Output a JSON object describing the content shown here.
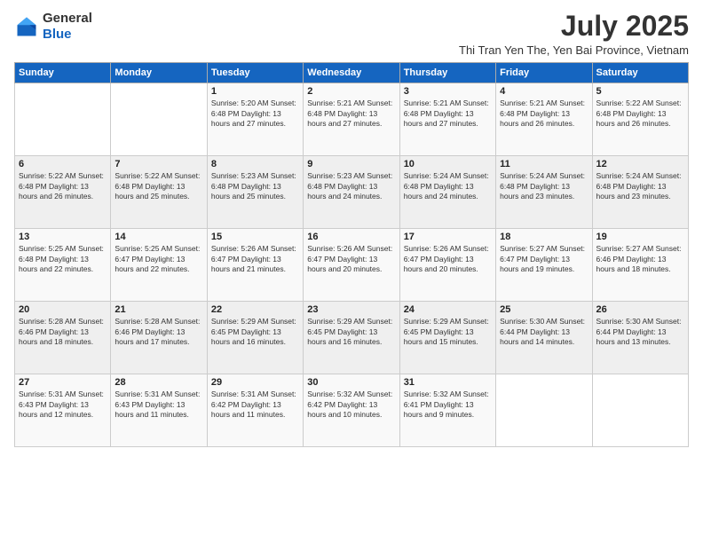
{
  "logo": {
    "line1": "General",
    "line2": "Blue"
  },
  "header": {
    "month_year": "July 2025",
    "location": "Thi Tran Yen The, Yen Bai Province, Vietnam"
  },
  "weekdays": [
    "Sunday",
    "Monday",
    "Tuesday",
    "Wednesday",
    "Thursday",
    "Friday",
    "Saturday"
  ],
  "weeks": [
    [
      {
        "day": "",
        "info": ""
      },
      {
        "day": "",
        "info": ""
      },
      {
        "day": "1",
        "info": "Sunrise: 5:20 AM\nSunset: 6:48 PM\nDaylight: 13 hours and 27 minutes."
      },
      {
        "day": "2",
        "info": "Sunrise: 5:21 AM\nSunset: 6:48 PM\nDaylight: 13 hours and 27 minutes."
      },
      {
        "day": "3",
        "info": "Sunrise: 5:21 AM\nSunset: 6:48 PM\nDaylight: 13 hours and 27 minutes."
      },
      {
        "day": "4",
        "info": "Sunrise: 5:21 AM\nSunset: 6:48 PM\nDaylight: 13 hours and 26 minutes."
      },
      {
        "day": "5",
        "info": "Sunrise: 5:22 AM\nSunset: 6:48 PM\nDaylight: 13 hours and 26 minutes."
      }
    ],
    [
      {
        "day": "6",
        "info": "Sunrise: 5:22 AM\nSunset: 6:48 PM\nDaylight: 13 hours and 26 minutes."
      },
      {
        "day": "7",
        "info": "Sunrise: 5:22 AM\nSunset: 6:48 PM\nDaylight: 13 hours and 25 minutes."
      },
      {
        "day": "8",
        "info": "Sunrise: 5:23 AM\nSunset: 6:48 PM\nDaylight: 13 hours and 25 minutes."
      },
      {
        "day": "9",
        "info": "Sunrise: 5:23 AM\nSunset: 6:48 PM\nDaylight: 13 hours and 24 minutes."
      },
      {
        "day": "10",
        "info": "Sunrise: 5:24 AM\nSunset: 6:48 PM\nDaylight: 13 hours and 24 minutes."
      },
      {
        "day": "11",
        "info": "Sunrise: 5:24 AM\nSunset: 6:48 PM\nDaylight: 13 hours and 23 minutes."
      },
      {
        "day": "12",
        "info": "Sunrise: 5:24 AM\nSunset: 6:48 PM\nDaylight: 13 hours and 23 minutes."
      }
    ],
    [
      {
        "day": "13",
        "info": "Sunrise: 5:25 AM\nSunset: 6:48 PM\nDaylight: 13 hours and 22 minutes."
      },
      {
        "day": "14",
        "info": "Sunrise: 5:25 AM\nSunset: 6:47 PM\nDaylight: 13 hours and 22 minutes."
      },
      {
        "day": "15",
        "info": "Sunrise: 5:26 AM\nSunset: 6:47 PM\nDaylight: 13 hours and 21 minutes."
      },
      {
        "day": "16",
        "info": "Sunrise: 5:26 AM\nSunset: 6:47 PM\nDaylight: 13 hours and 20 minutes."
      },
      {
        "day": "17",
        "info": "Sunrise: 5:26 AM\nSunset: 6:47 PM\nDaylight: 13 hours and 20 minutes."
      },
      {
        "day": "18",
        "info": "Sunrise: 5:27 AM\nSunset: 6:47 PM\nDaylight: 13 hours and 19 minutes."
      },
      {
        "day": "19",
        "info": "Sunrise: 5:27 AM\nSunset: 6:46 PM\nDaylight: 13 hours and 18 minutes."
      }
    ],
    [
      {
        "day": "20",
        "info": "Sunrise: 5:28 AM\nSunset: 6:46 PM\nDaylight: 13 hours and 18 minutes."
      },
      {
        "day": "21",
        "info": "Sunrise: 5:28 AM\nSunset: 6:46 PM\nDaylight: 13 hours and 17 minutes."
      },
      {
        "day": "22",
        "info": "Sunrise: 5:29 AM\nSunset: 6:45 PM\nDaylight: 13 hours and 16 minutes."
      },
      {
        "day": "23",
        "info": "Sunrise: 5:29 AM\nSunset: 6:45 PM\nDaylight: 13 hours and 16 minutes."
      },
      {
        "day": "24",
        "info": "Sunrise: 5:29 AM\nSunset: 6:45 PM\nDaylight: 13 hours and 15 minutes."
      },
      {
        "day": "25",
        "info": "Sunrise: 5:30 AM\nSunset: 6:44 PM\nDaylight: 13 hours and 14 minutes."
      },
      {
        "day": "26",
        "info": "Sunrise: 5:30 AM\nSunset: 6:44 PM\nDaylight: 13 hours and 13 minutes."
      }
    ],
    [
      {
        "day": "27",
        "info": "Sunrise: 5:31 AM\nSunset: 6:43 PM\nDaylight: 13 hours and 12 minutes."
      },
      {
        "day": "28",
        "info": "Sunrise: 5:31 AM\nSunset: 6:43 PM\nDaylight: 13 hours and 11 minutes."
      },
      {
        "day": "29",
        "info": "Sunrise: 5:31 AM\nSunset: 6:42 PM\nDaylight: 13 hours and 11 minutes."
      },
      {
        "day": "30",
        "info": "Sunrise: 5:32 AM\nSunset: 6:42 PM\nDaylight: 13 hours and 10 minutes."
      },
      {
        "day": "31",
        "info": "Sunrise: 5:32 AM\nSunset: 6:41 PM\nDaylight: 13 hours and 9 minutes."
      },
      {
        "day": "",
        "info": ""
      },
      {
        "day": "",
        "info": ""
      }
    ]
  ]
}
